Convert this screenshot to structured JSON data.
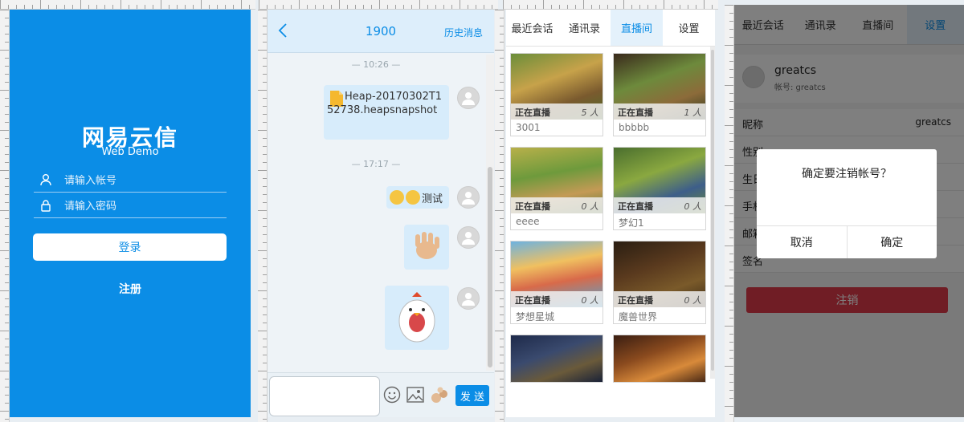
{
  "login": {
    "brand_cn": "网易云信",
    "brand_en": "Web Demo",
    "account_placeholder": "请输入帐号",
    "password_placeholder": "请输入密码",
    "login_button": "登录",
    "register_link": "注册",
    "bg_color": "#0b8de6"
  },
  "chat": {
    "back_icon": "chevron-left-icon",
    "title": "1900",
    "history_link": "历史消息",
    "messages": [
      {
        "time": "— 10:26 —",
        "text": "Heap-20170302T152738.heapsnapshot"
      },
      {
        "time": "— 17:17 —",
        "text": "测试"
      }
    ],
    "send_button": "发 送"
  },
  "live": {
    "tabs": [
      "最近会话",
      "通讯录",
      "直播间",
      "设置"
    ],
    "active_tab": "直播间",
    "rooms": [
      {
        "status": "正在直播",
        "viewers": "5 人",
        "name": "3001"
      },
      {
        "status": "正在直播",
        "viewers": "1 人",
        "name": "bbbbb"
      },
      {
        "status": "正在直播",
        "viewers": "0 人",
        "name": "eeee"
      },
      {
        "status": "正在直播",
        "viewers": "0 人",
        "name": "梦幻1"
      },
      {
        "status": "正在直播",
        "viewers": "0 人",
        "name": "梦想星城"
      },
      {
        "status": "正在直播",
        "viewers": "0 人",
        "name": "魔兽世界"
      }
    ]
  },
  "settings": {
    "tabs": [
      "最近会话",
      "通讯录",
      "直播间",
      "设置"
    ],
    "active_tab": "设置",
    "username": "greatcs",
    "account_label": "帐号: greatcs",
    "rows": [
      {
        "key": "昵称",
        "value": "greatcs"
      },
      {
        "key": "性别",
        "value": ""
      },
      {
        "key": "生日",
        "value": ""
      },
      {
        "key": "手机",
        "value": ""
      },
      {
        "key": "邮箱",
        "value": ""
      },
      {
        "key": "签名",
        "value": ""
      }
    ],
    "logout_button": "注销",
    "dialog": {
      "message": "确定要注销帐号？",
      "cancel": "取消",
      "confirm": "确定"
    }
  }
}
